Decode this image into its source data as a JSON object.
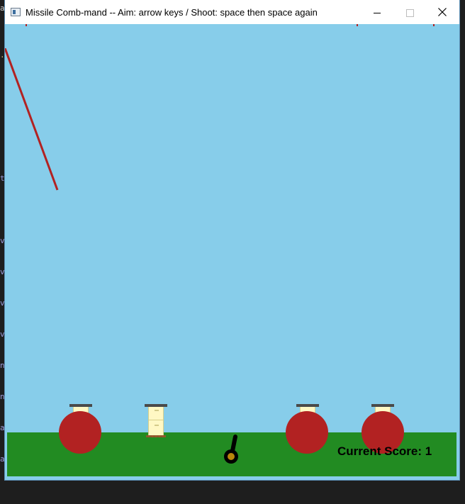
{
  "window": {
    "title": "Missile Comb-mand -- Aim: arrow keys / Shoot: space then space again"
  },
  "icons": {
    "app": "app-window-icon",
    "minimize": "minimize-icon",
    "maximize": "maximize-icon",
    "close": "close-icon"
  },
  "colors": {
    "sky": "#87cdea",
    "ground": "#228b22",
    "explosion": "#b22222",
    "missile_trail": "#b22222",
    "city": "#fff8c4",
    "city_cap": "#4a4a4a",
    "cannon": "#000000",
    "cannon_hub": "#b8860b"
  },
  "game": {
    "score_label": "Current Score: 1",
    "cities_standing": 1,
    "explosions_active": 4,
    "incoming_missiles": 1
  }
}
